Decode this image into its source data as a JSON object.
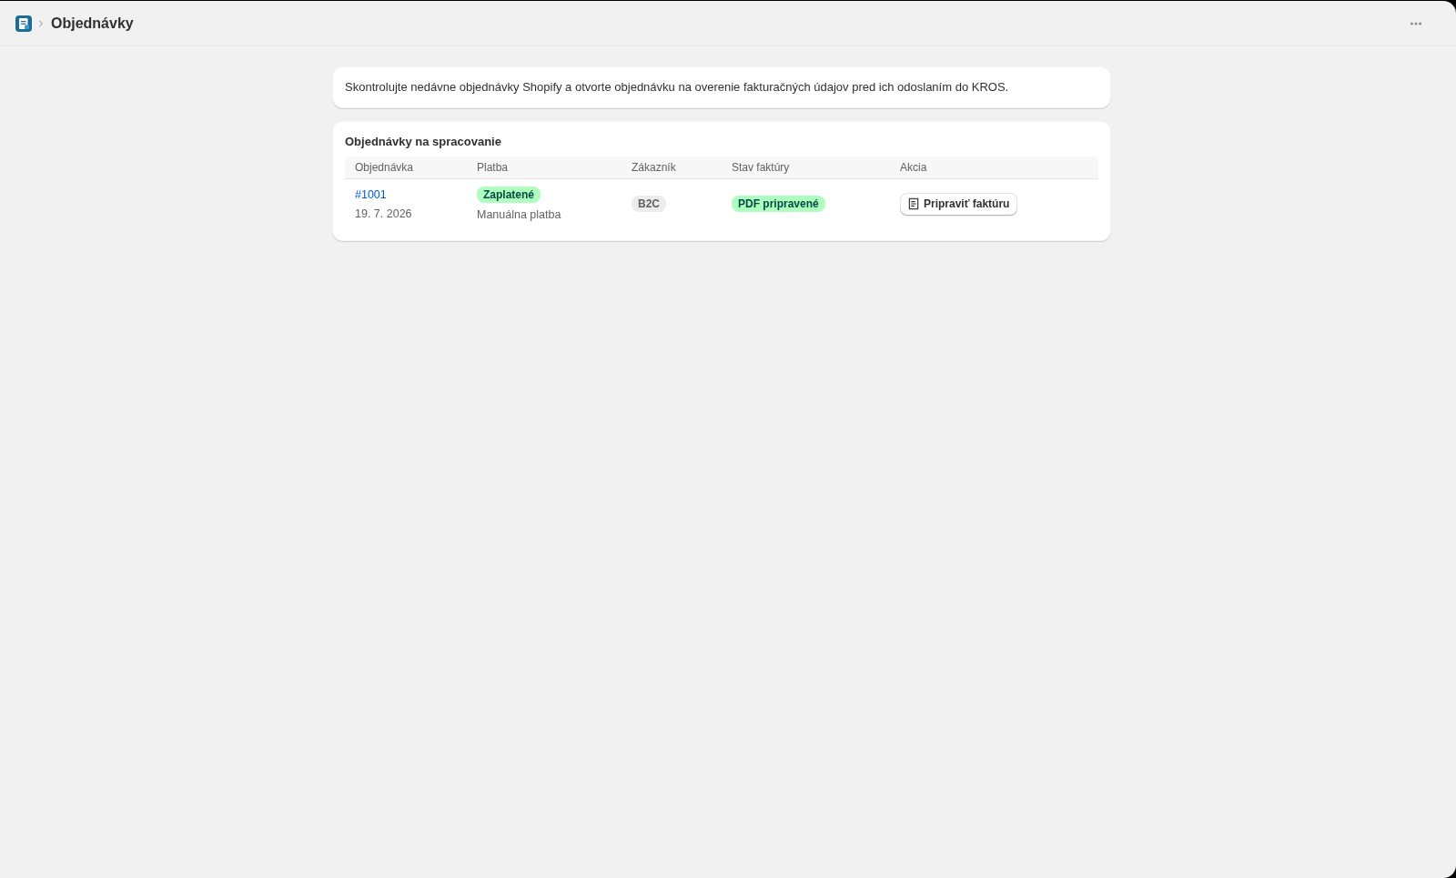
{
  "header": {
    "title": "Objednávky"
  },
  "info": {
    "text": "Skontrolujte nedávne objednávky Shopify a otvorte objednávku na overenie fakturačných údajov pred ich odoslaním do KROS."
  },
  "orders": {
    "title": "Objednávky na spracovanie",
    "columns": [
      "Objednávka",
      "Platba",
      "Zákazník",
      "Stav faktúry",
      "Akcia"
    ],
    "rows": [
      {
        "order": "#1001",
        "date": "19. 7. 2026",
        "payment_status": {
          "label": "Zaplatené",
          "kind": "success"
        },
        "payment_method": "Manuálna platba",
        "customer_type": {
          "label": "B2C",
          "kind": "neutral"
        },
        "invoice_status": {
          "label": "PDF pripravené",
          "kind": "success"
        },
        "action": "Pripraviť faktúru"
      }
    ]
  }
}
